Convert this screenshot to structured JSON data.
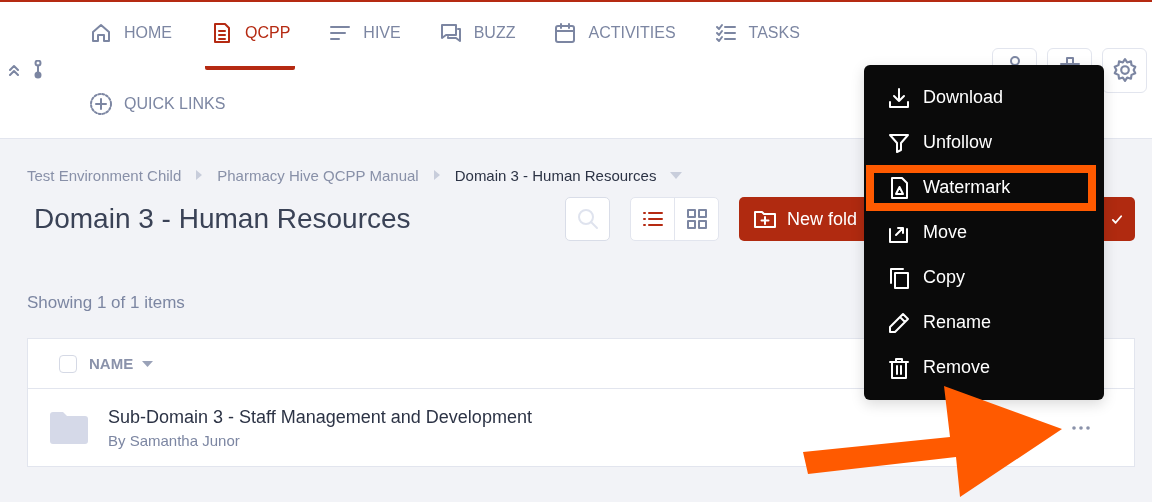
{
  "nav": {
    "tabs": [
      {
        "label": "HOME",
        "selected": false
      },
      {
        "label": "QCPP",
        "selected": true
      },
      {
        "label": "HIVE",
        "selected": false
      },
      {
        "label": "BUZZ",
        "selected": false
      },
      {
        "label": "ACTIVITIES",
        "selected": false
      },
      {
        "label": "TASKS",
        "selected": false
      }
    ],
    "quick_links": "QUICK LINKS"
  },
  "breadcrumb": [
    {
      "label": "Test Environment Child",
      "current": false
    },
    {
      "label": "Pharmacy Hive QCPP Manual",
      "current": false
    },
    {
      "label": "Domain 3 - Human Resources",
      "current": true
    }
  ],
  "title": "Domain 3 - Human Resources",
  "view_modes": [
    {
      "selected": true
    },
    {
      "selected": false
    }
  ],
  "new_folder_button": "New fold",
  "item_count": "Showing 1 of 1 items",
  "table": {
    "columns": [
      {
        "label": "NAME"
      }
    ],
    "select_all": {
      "checked": false
    },
    "rows": [
      {
        "name": "Sub-Domain 3 - Staff Management and Development",
        "author": "By Samantha Junor"
      }
    ]
  },
  "menu": {
    "items": [
      {
        "label": "Download",
        "highlighted": false
      },
      {
        "label": "Unfollow",
        "highlighted": false
      },
      {
        "label": "Watermark",
        "highlighted": true
      },
      {
        "label": "Move",
        "highlighted": false
      },
      {
        "label": "Copy",
        "highlighted": false
      },
      {
        "label": "Rename",
        "highlighted": false
      },
      {
        "label": "Remove",
        "highlighted": false
      }
    ]
  },
  "annotation": {
    "arrow": true
  }
}
